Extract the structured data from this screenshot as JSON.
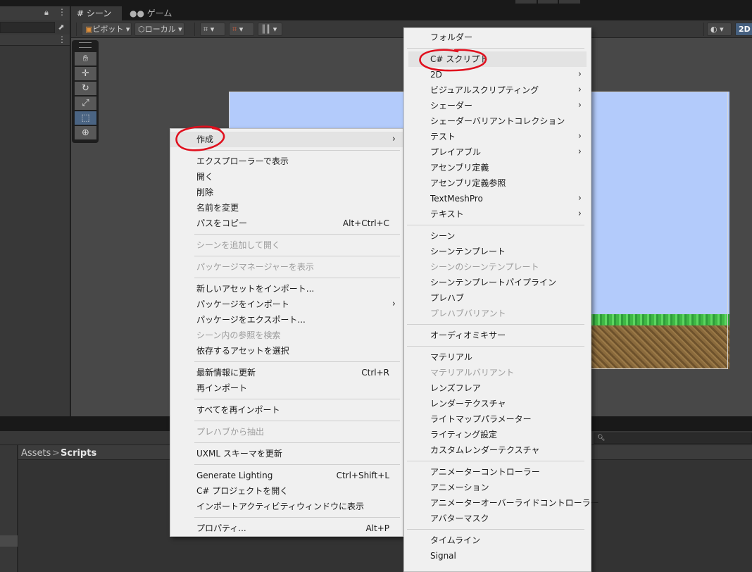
{
  "tabs": {
    "scene": "シーン",
    "game": "ゲーム"
  },
  "toolbar": {
    "pivot": "ピボット",
    "local": "ローカル",
    "mode_2d": "2D"
  },
  "breadcrumb": {
    "root": "Assets",
    "separator": ">",
    "current": "Scripts"
  },
  "context_menu": [
    {
      "label": "作成",
      "submenu": true,
      "highlighted": true
    },
    {
      "sep": true
    },
    {
      "label": "エクスプローラーで表示"
    },
    {
      "label": "開く"
    },
    {
      "label": "削除"
    },
    {
      "label": "名前を変更"
    },
    {
      "label": "パスをコピー",
      "shortcut": "Alt+Ctrl+C"
    },
    {
      "sep": true
    },
    {
      "label": "シーンを追加して開く",
      "disabled": true
    },
    {
      "sep": true
    },
    {
      "label": "パッケージマネージャーを表示",
      "disabled": true
    },
    {
      "sep": true
    },
    {
      "label": "新しいアセットをインポート..."
    },
    {
      "label": "パッケージをインポート",
      "submenu": true
    },
    {
      "label": "パッケージをエクスポート..."
    },
    {
      "label": "シーン内の参照を検索",
      "disabled": true
    },
    {
      "label": "依存するアセットを選択"
    },
    {
      "sep": true
    },
    {
      "label": "最新情報に更新",
      "shortcut": "Ctrl+R"
    },
    {
      "label": "再インポート"
    },
    {
      "sep": true
    },
    {
      "label": "すべてを再インポート"
    },
    {
      "sep": true
    },
    {
      "label": "プレハブから抽出",
      "disabled": true
    },
    {
      "sep": true
    },
    {
      "label": "UXML スキーマを更新"
    },
    {
      "sep": true
    },
    {
      "label": "Generate Lighting",
      "shortcut": "Ctrl+Shift+L"
    },
    {
      "label": "C# プロジェクトを開く"
    },
    {
      "label": "インポートアクティビティウィンドウに表示"
    },
    {
      "sep": true
    },
    {
      "label": "プロパティ...",
      "shortcut": "Alt+P"
    }
  ],
  "create_submenu": [
    {
      "label": "フォルダー"
    },
    {
      "sep": true
    },
    {
      "label": "C# スクリプト",
      "highlighted": true
    },
    {
      "label": "2D",
      "submenu": true
    },
    {
      "label": "ビジュアルスクリプティング",
      "submenu": true
    },
    {
      "label": "シェーダー",
      "submenu": true
    },
    {
      "label": "シェーダーバリアントコレクション"
    },
    {
      "label": "テスト",
      "submenu": true
    },
    {
      "label": "プレイアブル",
      "submenu": true
    },
    {
      "label": "アセンブリ定義"
    },
    {
      "label": "アセンブリ定義参照"
    },
    {
      "label": "TextMeshPro",
      "submenu": true
    },
    {
      "label": "テキスト",
      "submenu": true
    },
    {
      "sep": true
    },
    {
      "label": "シーン"
    },
    {
      "label": "シーンテンプレート"
    },
    {
      "label": "シーンのシーンテンプレート",
      "disabled": true
    },
    {
      "label": "シーンテンプレートパイプライン"
    },
    {
      "label": "プレハブ"
    },
    {
      "label": "プレハブバリアント",
      "disabled": true
    },
    {
      "sep": true
    },
    {
      "label": "オーディオミキサー"
    },
    {
      "sep": true
    },
    {
      "label": "マテリアル"
    },
    {
      "label": "マテリアルバリアント",
      "disabled": true
    },
    {
      "label": "レンズフレア"
    },
    {
      "label": "レンダーテクスチャ"
    },
    {
      "label": "ライトマップパラメーター"
    },
    {
      "label": "ライティング設定"
    },
    {
      "label": "カスタムレンダーテクスチャ"
    },
    {
      "sep": true
    },
    {
      "label": "アニメーターコントローラー"
    },
    {
      "label": "アニメーション"
    },
    {
      "label": "アニメーターオーバーライドコントローラー"
    },
    {
      "label": "アバターマスク"
    },
    {
      "sep": true
    },
    {
      "label": "タイムライン"
    },
    {
      "label": "Signal"
    }
  ],
  "colors": {
    "annotation": "#e0101e",
    "sky": "#b3cbfb",
    "menu_bg": "#f0f0f0"
  }
}
